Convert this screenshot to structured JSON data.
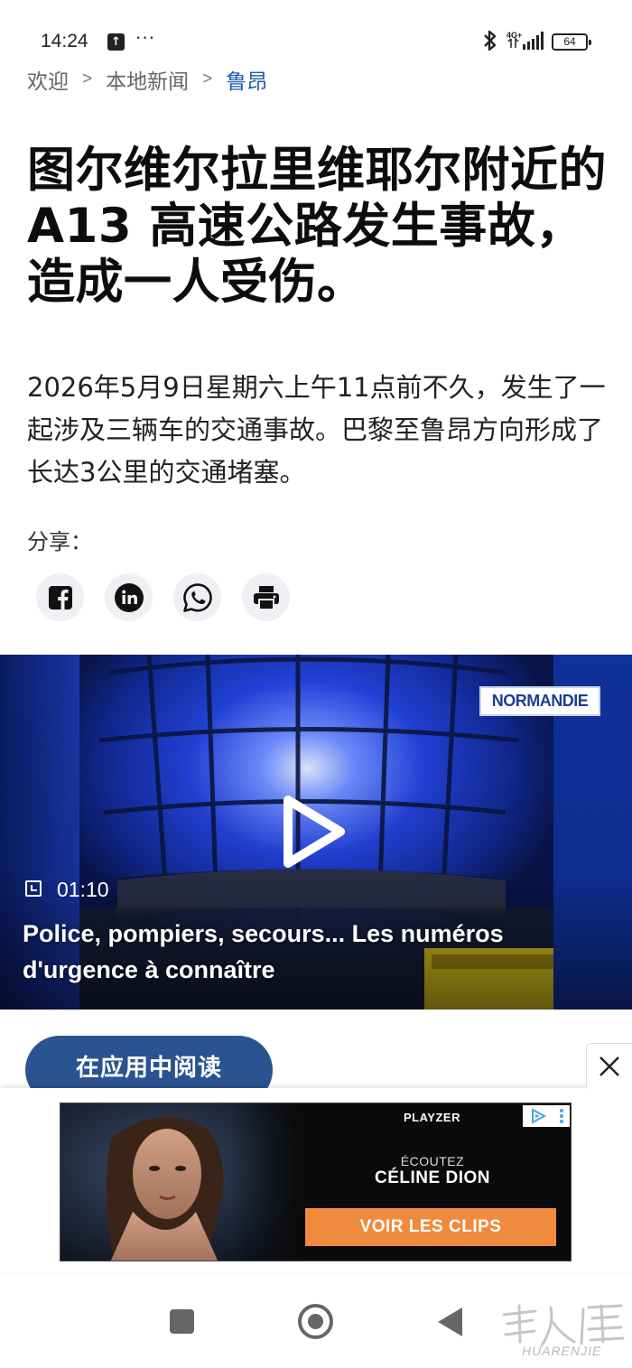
{
  "status_bar": {
    "time": "14:24",
    "more": "···",
    "network": "4G+",
    "battery": "64"
  },
  "breadcrumb": {
    "items": [
      "欢迎",
      "本地新闻"
    ],
    "current": "鲁昂",
    "separator": ">"
  },
  "article": {
    "headline": "图尔维尔拉里维耶尔附近的 A13 高速公路发生事故，造成一人受伤。",
    "lede": "2026年5月9日星期六上午11点前不久，发生了一起涉及三辆车的交通事故。巴黎至鲁昂方向形成了长达3公里的交通堵塞。"
  },
  "share": {
    "label": "分享：",
    "buttons": [
      {
        "name": "facebook",
        "icon": "facebook-icon"
      },
      {
        "name": "linkedin",
        "icon": "linkedin-icon"
      },
      {
        "name": "whatsapp",
        "icon": "whatsapp-icon"
      },
      {
        "name": "print",
        "icon": "printer-icon"
      }
    ]
  },
  "video": {
    "logo": "NORMANDIE",
    "duration": "01:10",
    "title": "Police, pompiers, secours... Les numéros d'urgence à connaître"
  },
  "read_in_app": {
    "label": "在应用中阅读"
  },
  "ad": {
    "brand": "PLAYZER",
    "listen": "ÉCOUTEZ",
    "artist": "CÉLINE DION",
    "cta": "VOIR LES CLIPS"
  },
  "watermark": {
    "text": "HUARENJIE"
  },
  "colors": {
    "breadcrumb_current": "#1a5ea8",
    "read_app_button": "#2b5391",
    "ad_cta": "#f08a3c",
    "video_bg": "#0b1d55"
  }
}
